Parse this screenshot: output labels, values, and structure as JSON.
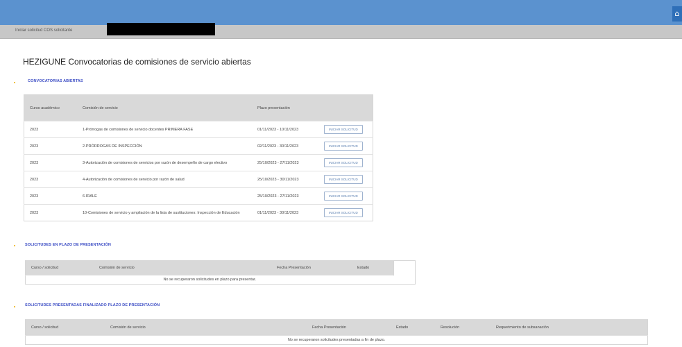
{
  "header": {
    "breadcrumb": "Iniciar solicitud COS solicitante",
    "corner_icon": "home-icon"
  },
  "page": {
    "title": "HEZIGUNE Convocatorias de comisiones de servicio abiertas"
  },
  "convocatorias": {
    "section_title": "CONVOCATORIAS ABIERTAS",
    "columns": [
      "Curso académico",
      "Comisión de servicio",
      "Plazo presentación"
    ],
    "rows": [
      {
        "curso": "2023",
        "comision": "1-Prórrogas de comisiones de servicio docentes PRIMERA FASE",
        "plazo": "01/11/2023 - 10/11/2023",
        "button": "INICIAR SOLICITUD"
      },
      {
        "curso": "2023",
        "comision": "2-PRÓRROGAS DE INSPECCIÓN",
        "plazo": "02/11/2023 - 30/11/2023",
        "button": "INICIAR SOLICITUD"
      },
      {
        "curso": "2023",
        "comision": "3-Autorización de comisiones de servicios por razón de desempeño de cargo electivo",
        "plazo": "25/10/2023 - 27/11/2023",
        "button": "INICIAR SOLICITUD"
      },
      {
        "curso": "2023",
        "comision": "4-Autorización de comisiones de servicio por razón de salud",
        "plazo": "25/10/2023 - 30/11/2023",
        "button": "INICIAR SOLICITUD"
      },
      {
        "curso": "2023",
        "comision": "6-IRALE",
        "plazo": "25/10/2023 - 27/11/2023",
        "button": "INICIAR SOLICITUD"
      },
      {
        "curso": "2023",
        "comision": "10-Comisiones de servicio y ampliación de la lista de sustituciones: Inspección de Educación",
        "plazo": "01/11/2023 - 30/11/2023",
        "button": "INICIAR SOLICITUD"
      }
    ]
  },
  "en_plazo": {
    "section_title": "SOLICITUDES EN PLAZO DE PRESENTACIÓN",
    "columns": [
      "Curso / solicitud",
      "Comisión de servicio",
      "Fecha Presentación",
      "Estado"
    ],
    "empty_message": "No se recuperaron solicitudes en plazo para presentar."
  },
  "finalizado": {
    "section_title": "SOLICITUDES PRESENTADAS FINALIZADO PLAZO DE PRESENTACIÓN",
    "columns": [
      "Curso / solicitud",
      "Comisión de servicio",
      "Fecha Presentación",
      "Estado",
      "Resolución",
      "Requerimiento de subsanación"
    ],
    "empty_message": "No se recuperaron solicitudes presentadas a fin de plazo."
  },
  "colors": {
    "topbar": "#5b92cf",
    "subbar": "#c7c7c7",
    "section_title": "#3b4cc4",
    "table_header": "#d9d9d9",
    "button_text": "#5a7fb0"
  }
}
